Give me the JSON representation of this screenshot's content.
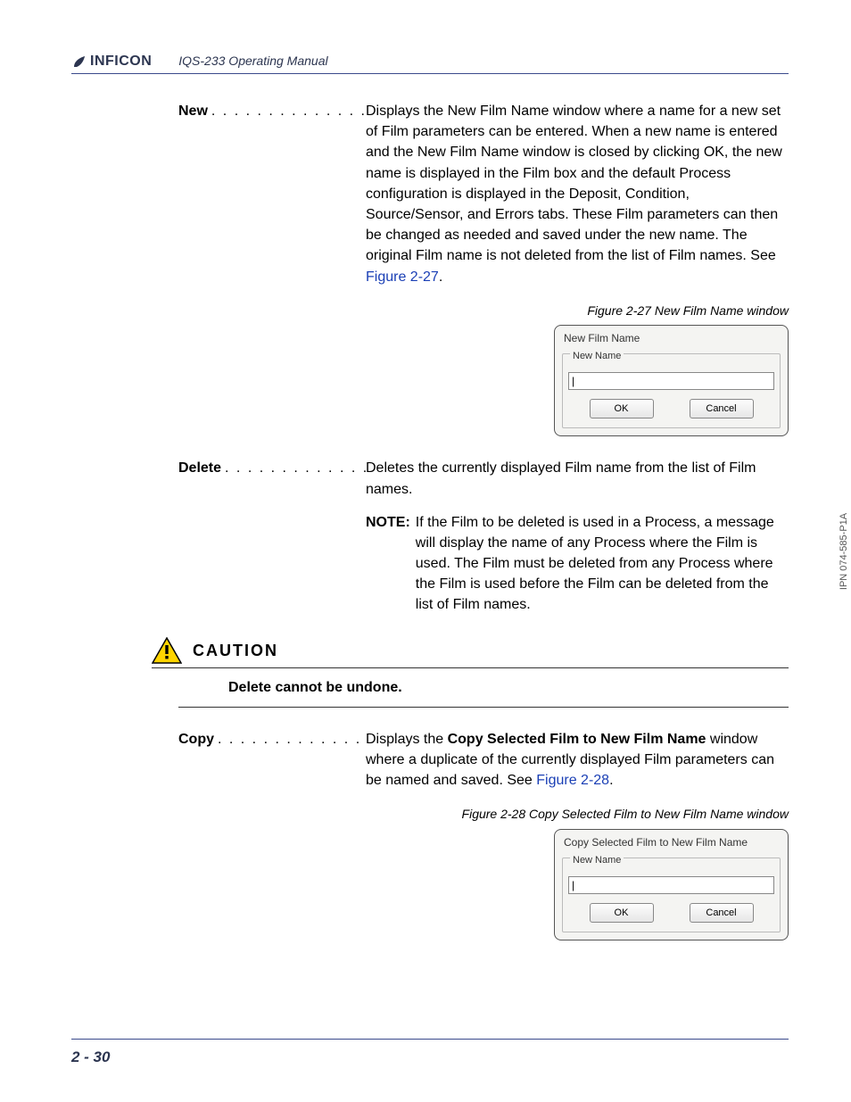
{
  "header": {
    "brand": "INFICON",
    "manual_title": "IQS-233 Operating Manual"
  },
  "side_ipn": "IPN 074-585-P1A",
  "page_number": "2 - 30",
  "dots": ". . . . . . . . . . . . . . . . . . . . . . . . . . .",
  "new": {
    "term": "New",
    "desc": "Displays the New Film Name window where a name for a new set of Film parameters can be entered. When a new name is entered and the New Film Name window is closed by clicking OK, the new name is displayed in the Film box and the default Process configuration is displayed in the Deposit, Condition, Source/Sensor, and Errors tabs. These Film parameters can then be changed as needed and saved under the new name. The original Film name is not deleted from the list of Film names. See ",
    "figref": "Figure 2-27",
    "period": "."
  },
  "figure27": {
    "caption": "Figure 2-27  New Film Name window",
    "title": "New Film Name",
    "group_label": "New Name",
    "input_value": "|",
    "ok": "OK",
    "cancel": "Cancel"
  },
  "delete": {
    "term": "Delete",
    "desc": "Deletes the currently displayed Film name from the list of Film names.",
    "note_label": "NOTE:",
    "note_text": "If the Film to be deleted is used in a Process, a message will display the name of any Process where the Film is used. The Film must be deleted from any Process where the Film is used before the Film can be deleted from the list of Film names."
  },
  "caution": {
    "title": "CAUTION",
    "body": "Delete cannot be undone."
  },
  "copy": {
    "term": "Copy",
    "desc_pre": "Displays the ",
    "desc_bold": "Copy Selected Film to New Film Name",
    "desc_post": " window where a duplicate of the currently displayed Film parameters can be named and saved. See ",
    "figref": "Figure 2-28",
    "period": "."
  },
  "figure28": {
    "caption": "Figure 2-28  Copy Selected Film to New Film Name window",
    "title": "Copy Selected Film to New Film Name",
    "group_label": "New Name",
    "input_value": "|",
    "ok": "OK",
    "cancel": "Cancel"
  }
}
